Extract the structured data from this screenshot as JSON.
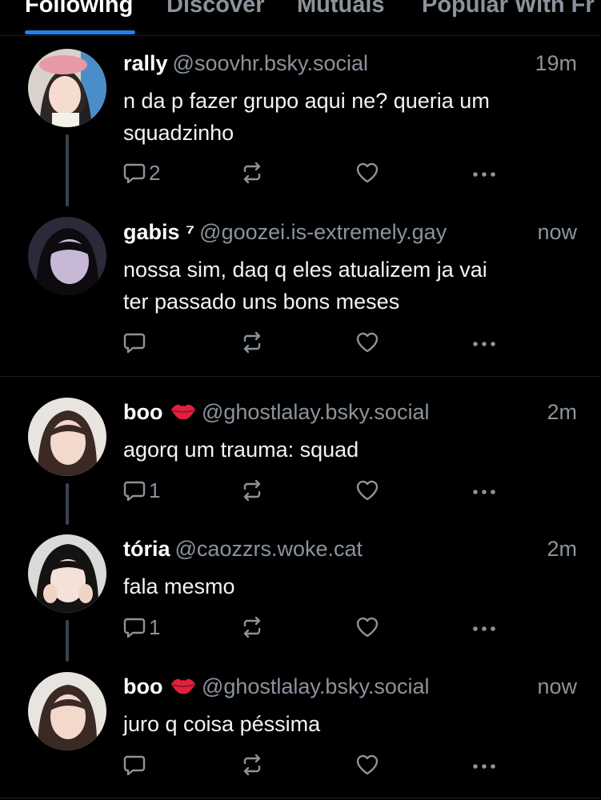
{
  "tabs": [
    "Following",
    "Discover",
    "Mutuals",
    "Popular With Fr"
  ],
  "posts": [
    {
      "name": "rally",
      "handle": "@soovhr.bsky.social",
      "time": "19m",
      "text": "n da p fazer grupo aqui ne? queria um\nsquadzinho",
      "replies": "2"
    },
    {
      "name": "gabis ⁷",
      "handle": "@goozei.is-extremely.gay",
      "time": "now",
      "text": "nossa sim, daq q eles atualizem ja vai\nter passado uns bons meses",
      "replies": ""
    },
    {
      "name": "boo",
      "handle": "@ghostlalay.bsky.social",
      "time": "2m",
      "text": "agorq um trauma: squad",
      "replies": "1"
    },
    {
      "name": "tória",
      "handle": "@caozzrs.woke.cat",
      "time": "2m",
      "text": "fala mesmo",
      "replies": "1"
    },
    {
      "name": "boo",
      "handle": "@ghostlalay.bsky.social",
      "time": "now",
      "text": "juro q coisa péssima",
      "replies": ""
    }
  ],
  "icons": {
    "reply": "speech-bubble-icon",
    "repost": "repost-arrows-icon",
    "like": "heart-icon",
    "more": "ellipsis-icon",
    "lips": "kiss-lips-emoji"
  },
  "colors": {
    "background": "#000000",
    "accent": "#1d82f0",
    "muted": "#8b939c",
    "lips": "#e0213e"
  }
}
